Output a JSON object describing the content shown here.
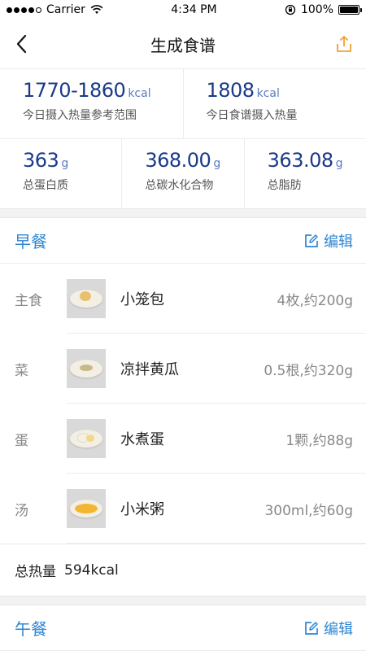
{
  "status_bar": {
    "carrier": "Carrier",
    "time": "4:34 PM",
    "battery": "100%",
    "battery_level": 1.0
  },
  "nav": {
    "title": "生成食谱",
    "back_icon": "chevron-left-icon",
    "share_icon": "share-icon",
    "share_color": "#f0a030"
  },
  "stats": {
    "range": {
      "value": "1770-1860",
      "unit": "kcal",
      "label": "今日摄入热量参考范围"
    },
    "recipe_kcal": {
      "value": "1808",
      "unit": "kcal",
      "label": "今日食谱摄入热量"
    },
    "protein": {
      "value": "363",
      "unit": "g",
      "label": "总蛋白质"
    },
    "carbs": {
      "value": "368.00",
      "unit": "g",
      "label": "总碳水化合物"
    },
    "fat": {
      "value": "363.08",
      "unit": "g",
      "label": "总脂肪"
    }
  },
  "breakfast": {
    "title": "早餐",
    "edit_label": "编辑",
    "items": [
      {
        "category": "主食",
        "name": "小笼包",
        "amount": "4枚,约200g"
      },
      {
        "category": "菜",
        "name": "凉拌黄瓜",
        "amount": "0.5根,约320g"
      },
      {
        "category": "蛋",
        "name": "水煮蛋",
        "amount": "1颗,约88g"
      },
      {
        "category": "汤",
        "name": "小米粥",
        "amount": "300ml,约60g"
      }
    ],
    "total_label": "总热量",
    "total_value": "594kcal"
  },
  "lunch": {
    "title": "午餐",
    "edit_label": "编辑"
  },
  "colors": {
    "accent": "#2f86d3",
    "stat_value": "#1a3a8a"
  }
}
